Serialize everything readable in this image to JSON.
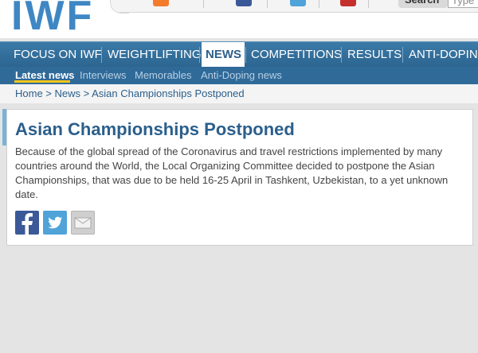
{
  "header": {
    "logo_text": "IWF",
    "search_label": "Search",
    "search_placeholder": "Type"
  },
  "colors": {
    "logo": "#3f87c4",
    "nav": "#2f6a99",
    "link": "#2b5f8c",
    "highlight": "#f5c518",
    "rss": "#f47c2c",
    "facebook": "#3b5998",
    "twitter": "#4fa3d9",
    "youtube": "#c4302b"
  },
  "main_nav": [
    {
      "label": "FOCUS ON IWF"
    },
    {
      "label": "WEIGHTLIFTING"
    },
    {
      "label": "NEWS",
      "active": true
    },
    {
      "label": "COMPETITIONS"
    },
    {
      "label": "RESULTS"
    },
    {
      "label": "ANTI-DOPING"
    }
  ],
  "sub_nav": [
    {
      "label": "Latest news",
      "active": true
    },
    {
      "label": "Interviews"
    },
    {
      "label": "Memorables"
    },
    {
      "label": "Anti-Doping news"
    }
  ],
  "breadcrumb": {
    "text": "Home > News > Asian Championships Postponed"
  },
  "article": {
    "title": "Asian Championships Postponed",
    "body": "Because of the global spread of the Coronavirus and travel restrictions implemented by many countries around the World, the Local Organizing Committee decided to postpone the Asian Championships, that was due to be held 16-25 April in Tashkent, Uzbekistan, to a yet unknown date."
  },
  "share_icons": [
    "facebook-icon",
    "twitter-icon",
    "email-icon"
  ]
}
